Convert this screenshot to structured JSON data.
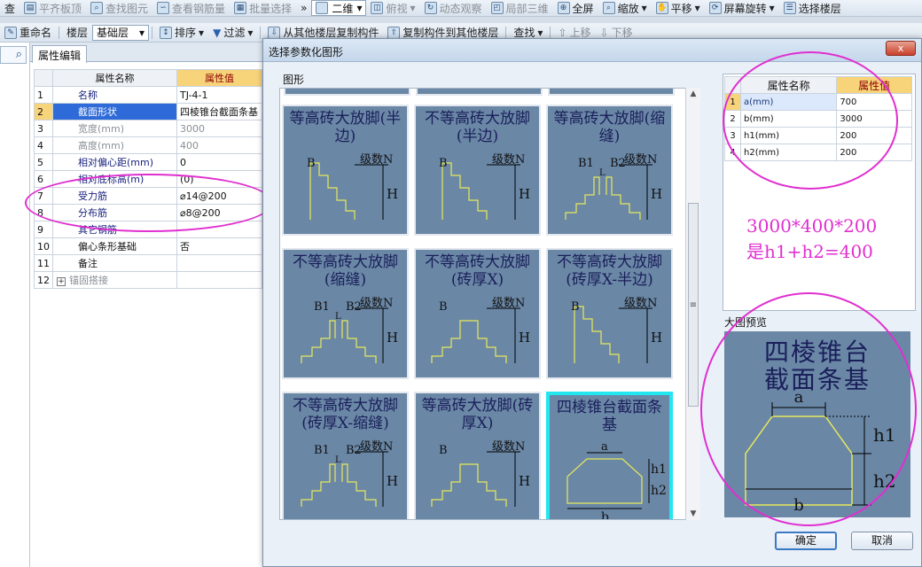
{
  "toolbar1": {
    "items": [
      "查",
      "平齐板顶",
      "查找图元",
      "查看钢筋量",
      "批量选择",
      "»",
      "二维",
      "俯视",
      "动态观察",
      "局部三维",
      "全屏",
      "缩放",
      "平移",
      "屏幕旋转",
      "选择楼层"
    ]
  },
  "toolbar2": {
    "rename": "重命名",
    "floor_label": "楼层",
    "floor_value": "基础层",
    "sort": "排序",
    "filter": "过滤",
    "copy_from": "从其他楼层复制构件",
    "copy_to": "复制构件到其他楼层",
    "find": "查找",
    "up": "上移",
    "down": "下移"
  },
  "panel": {
    "tab": "属性编辑",
    "header_name": "属性名称",
    "header_value": "属性值",
    "rows": [
      {
        "n": "1",
        "name": "名称",
        "value": "TJ-4-1",
        "style": "blue"
      },
      {
        "n": "2",
        "name": "截面形状",
        "value": "四棱锥台截面条基",
        "style": "sel"
      },
      {
        "n": "3",
        "name": "宽度(mm)",
        "value": "3000",
        "style": "grey"
      },
      {
        "n": "4",
        "name": "高度(mm)",
        "value": "400",
        "style": "grey"
      },
      {
        "n": "5",
        "name": "相对偏心距(mm)",
        "value": "0",
        "style": "blue"
      },
      {
        "n": "6",
        "name": "相对底标高(m)",
        "value": "(0)",
        "style": "blue"
      },
      {
        "n": "7",
        "name": "受力筋",
        "value": "⌀14@200",
        "style": "blue"
      },
      {
        "n": "8",
        "name": "分布筋",
        "value": "⌀8@200",
        "style": "blue"
      },
      {
        "n": "9",
        "name": "其它钢筋",
        "value": "",
        "style": "blue"
      },
      {
        "n": "10",
        "name": "偏心条形基础",
        "value": "否",
        "style": "plain"
      },
      {
        "n": "11",
        "name": "备注",
        "value": "",
        "style": "plain"
      },
      {
        "n": "12",
        "name": "锚固搭接",
        "value": "",
        "style": "grey",
        "plus": "+"
      }
    ]
  },
  "dialog": {
    "title": "选择参数化图形",
    "close": "x",
    "graph_label": "图形",
    "tiles": [
      {
        "title": "等高砖大放脚(半边)",
        "labels": [
          "B",
          "级数N",
          "H"
        ]
      },
      {
        "title": "不等高砖大放脚(半边)",
        "labels": [
          "B",
          "级数N",
          "H"
        ]
      },
      {
        "title": "等高砖大放脚(缩缝)",
        "labels": [
          "B1",
          "B2",
          "级数N",
          "H",
          "L"
        ]
      },
      {
        "title": "不等高砖大放脚(缩缝)",
        "labels": [
          "B1",
          "B2",
          "级数N",
          "H",
          "L"
        ]
      },
      {
        "title": "不等高砖大放脚(砖厚X)",
        "labels": [
          "B",
          "级数N",
          "H"
        ]
      },
      {
        "title": "不等高砖大放脚(砖厚X-半边)",
        "labels": [
          "B",
          "级数N",
          "H"
        ]
      },
      {
        "title": "不等高砖大放脚(砖厚X-缩缝)",
        "labels": [
          "B1",
          "B2",
          "级数N",
          "H",
          "L"
        ]
      },
      {
        "title": "等高砖大放脚(砖厚X)",
        "labels": [
          "B",
          "级数N",
          "H"
        ]
      },
      {
        "title": "四棱锥台截面条基",
        "labels": [
          "a",
          "h1",
          "h2",
          "b"
        ]
      }
    ],
    "params": {
      "header_name": "属性名称",
      "header_value": "属性值",
      "rows": [
        {
          "n": "1",
          "name": "a(mm)",
          "value": "700"
        },
        {
          "n": "2",
          "name": "b(mm)",
          "value": "3000"
        },
        {
          "n": "3",
          "name": "h1(mm)",
          "value": "200"
        },
        {
          "n": "4",
          "name": "h2(mm)",
          "value": "200"
        }
      ]
    },
    "annotation": [
      "3000*400*200",
      "是h1+h2=400"
    ],
    "preview_label": "大图预览",
    "preview_title": [
      "四棱锥台",
      "截面条基"
    ],
    "preview_labels": [
      "a",
      "h1",
      "h2",
      "b"
    ],
    "ok": "确定",
    "cancel": "取消"
  },
  "colors": {
    "annotation": "#e02fd0",
    "tile_bg": "#6a87a6",
    "selected_tile_border": "#22e6f0",
    "header_value_bg": "#f7d37a"
  }
}
